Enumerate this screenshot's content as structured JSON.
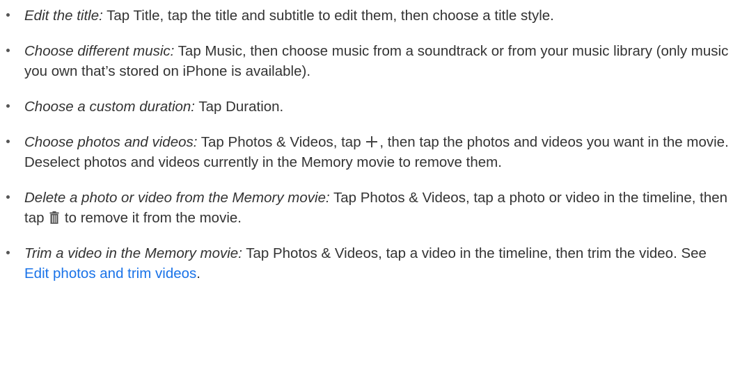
{
  "items": [
    {
      "term": "Edit the title:",
      "text": " Tap Title, tap the title and subtitle to edit them, then choose a title style."
    },
    {
      "term": "Choose different music:",
      "text": " Tap Music, then choose music from a soundtrack or from your music library (only music you own that’s stored on iPhone is available)."
    },
    {
      "term": "Choose a custom duration:",
      "text": " Tap Duration."
    },
    {
      "term": "Choose photos and videos:",
      "text_before_icon": " Tap Photos & Videos, tap",
      "icon": "plus-icon",
      "text_after_icon": ", then tap the photos and videos you want in the movie. Deselect photos and videos currently in the Memory movie to remove them."
    },
    {
      "term": "Delete a photo or video from the Memory movie:",
      "text_before_icon": " Tap Photos & Videos, tap a photo or video in the timeline, then tap",
      "icon": "trash-icon",
      "text_after_icon": "to remove it from the movie."
    },
    {
      "term": "Trim a video in the Memory movie:",
      "text_before_link": " Tap Photos & Videos, tap a video in the timeline, then trim the video. See ",
      "link_text": "Edit photos and trim videos",
      "text_after_link": "."
    }
  ],
  "colors": {
    "text": "#333333",
    "link": "#1a73e8",
    "bullet": "#555555"
  }
}
